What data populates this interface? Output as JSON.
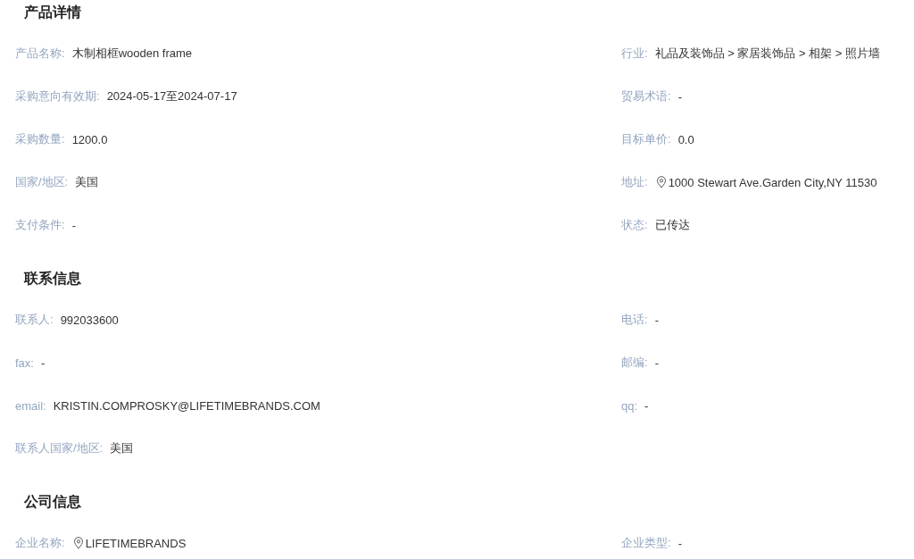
{
  "sections": [
    {
      "title": "产品详情",
      "rows": [
        {
          "left": {
            "kind": "plain",
            "label": "产品名称:",
            "value": "木制相框wooden frame"
          },
          "right": {
            "kind": "plain",
            "label": "行业:",
            "value": "礼品及装饰品 > 家居装饰品 > 相架 > 照片墙"
          }
        },
        {
          "left": {
            "kind": "plain",
            "label": "采购意向有效期:",
            "value": "2024-05-17至2024-07-17"
          },
          "right": {
            "kind": "plain",
            "label": "贸易术语:",
            "value": "-"
          }
        },
        {
          "left": {
            "kind": "plain",
            "label": "采购数量:",
            "value": "1200.0"
          },
          "right": {
            "kind": "plain",
            "label": "目标单价:",
            "value": "0.0"
          }
        },
        {
          "left": {
            "kind": "plain",
            "label": "国家/地区:",
            "value": "美国"
          },
          "right": {
            "kind": "location",
            "label": "地址:",
            "value": "1000 Stewart Ave.Garden City,NY 11530"
          }
        },
        {
          "left": {
            "kind": "plain",
            "label": "支付条件:",
            "value": "-"
          },
          "right": {
            "kind": "plain",
            "label": "状态:",
            "value": "已传达"
          }
        }
      ]
    },
    {
      "title": "联系信息",
      "rows": [
        {
          "left": {
            "kind": "plain",
            "label": "联系人:",
            "value": "992033600"
          },
          "right": {
            "kind": "plain",
            "label": "电话:",
            "value": "-"
          }
        },
        {
          "left": {
            "kind": "plain",
            "label": "fax:",
            "value": "-"
          },
          "right": {
            "kind": "plain",
            "label": "邮编:",
            "value": "-"
          }
        },
        {
          "left": {
            "kind": "plain",
            "label": "email:",
            "value": "KRISTIN.COMPROSKY@LIFETIMEBRANDS.COM"
          },
          "right": {
            "kind": "plain",
            "label": "qq:",
            "value": "-"
          }
        },
        {
          "left": {
            "kind": "plain",
            "label": "联系人国家/地区:",
            "value": "美国"
          }
        }
      ]
    },
    {
      "title": "公司信息",
      "rows": [
        {
          "left": {
            "kind": "location",
            "label": "企业名称:",
            "value": "LIFETIMEBRANDS"
          },
          "right": {
            "kind": "plain",
            "label": "企业类型:",
            "value": "-"
          }
        }
      ]
    }
  ]
}
